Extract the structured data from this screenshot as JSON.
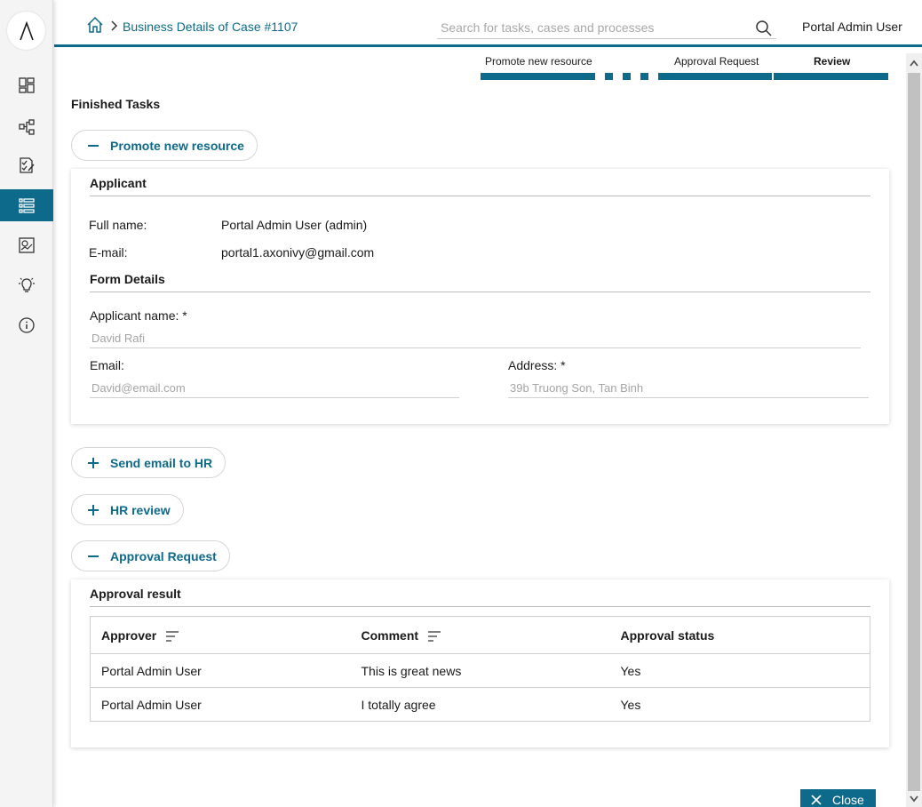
{
  "header": {
    "breadcrumb": "Business Details of Case #1107",
    "search_placeholder": "Search for tasks, cases and processes",
    "user_name": "Portal Admin User"
  },
  "sidebar": {
    "logo_text": "Λ",
    "items": [
      {
        "name": "dashboard",
        "icon": "dashboard-icon",
        "active": false
      },
      {
        "name": "processes",
        "icon": "process-icon",
        "active": false
      },
      {
        "name": "tasks",
        "icon": "task-icon",
        "active": false
      },
      {
        "name": "cases",
        "icon": "case-list-icon",
        "active": true
      },
      {
        "name": "statistics",
        "icon": "statistics-icon",
        "active": false
      },
      {
        "name": "ideas",
        "icon": "lightbulb-icon",
        "active": false
      },
      {
        "name": "about",
        "icon": "info-icon",
        "active": false
      }
    ]
  },
  "stepper": {
    "steps": [
      "Promote new resource",
      "Approval Request",
      "Review"
    ],
    "current": "Review"
  },
  "finished_tasks_title": "Finished Tasks",
  "tasks": [
    {
      "label": "Promote new resource",
      "expanded": true
    },
    {
      "label": "Send email to HR",
      "expanded": false
    },
    {
      "label": "HR review",
      "expanded": false
    },
    {
      "label": "Approval Request",
      "expanded": true
    }
  ],
  "applicant_card": {
    "applicant_heading": "Applicant",
    "full_name_label": "Full name:",
    "full_name_value": "Portal Admin User (admin)",
    "email_label": "E-mail:",
    "email_value": "portal1.axonivy@gmail.com",
    "form_heading": "Form Details",
    "applicant_name_label": "Applicant name:",
    "applicant_name_value": "David Rafi",
    "email_field_label": "Email:",
    "email_field_value": "David@email.com",
    "address_label": "Address:",
    "address_value": "39b Truong Son, Tan Binh",
    "required_mark": "*"
  },
  "approval_card": {
    "heading": "Approval result",
    "columns": [
      "Approver",
      "Comment",
      "Approval status"
    ],
    "rows": [
      [
        "Portal Admin User",
        "This is great news",
        "Yes"
      ],
      [
        "Portal Admin User",
        "I totally agree",
        "Yes"
      ]
    ]
  },
  "close_button": "Close",
  "colors": {
    "primary": "#0e6a8a",
    "sidebar_bg": "#f4f4f4",
    "border": "#cfcfcf"
  }
}
